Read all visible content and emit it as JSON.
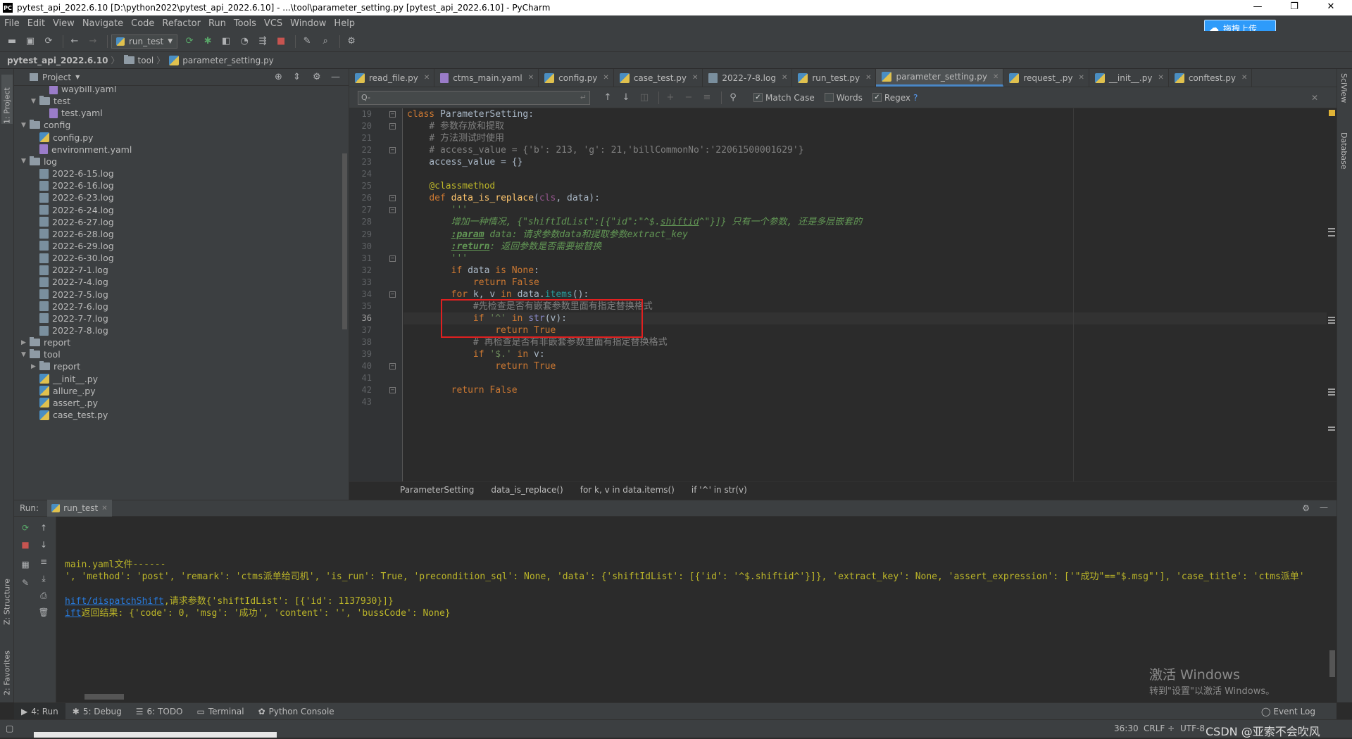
{
  "window": {
    "title": "pytest_api_2022.6.10 [D:\\python2022\\pytest_api_2022.6.10] - ...\\tool\\parameter_setting.py [pytest_api_2022.6.10] - PyCharm",
    "app_icon": "PC",
    "minimize": "—",
    "maximize": "❐",
    "close": "✕"
  },
  "menu": [
    "File",
    "Edit",
    "View",
    "Navigate",
    "Code",
    "Refactor",
    "Run",
    "Tools",
    "VCS",
    "Window",
    "Help"
  ],
  "upload_button": {
    "label": "拖拽上传",
    "icon": "cloud-icon"
  },
  "toolbar": {
    "run_config": "run_test"
  },
  "breadcrumb": [
    "pytest_api_2022.6.10",
    "tool",
    "parameter_setting.py"
  ],
  "left_stripe": {
    "project": "1: Project",
    "structure": "Z: Structure",
    "favorites": "2: Favorites"
  },
  "right_stripe": {
    "sciview": "SciView",
    "database": "Database"
  },
  "project_panel": {
    "title": "Project",
    "tree": [
      {
        "label": "waybill.yaml",
        "indent": 3,
        "kind": "yml",
        "arrow": ""
      },
      {
        "label": "test",
        "indent": 2,
        "kind": "folder",
        "arrow": "▼"
      },
      {
        "label": "test.yaml",
        "indent": 3,
        "kind": "yml",
        "arrow": ""
      },
      {
        "label": "config",
        "indent": 1,
        "kind": "folder",
        "arrow": "▼"
      },
      {
        "label": "config.py",
        "indent": 2,
        "kind": "py",
        "arrow": ""
      },
      {
        "label": "environment.yaml",
        "indent": 2,
        "kind": "yml",
        "arrow": ""
      },
      {
        "label": "log",
        "indent": 1,
        "kind": "folder",
        "arrow": "▼"
      },
      {
        "label": "2022-6-15.log",
        "indent": 2,
        "kind": "log",
        "arrow": ""
      },
      {
        "label": "2022-6-16.log",
        "indent": 2,
        "kind": "log",
        "arrow": ""
      },
      {
        "label": "2022-6-23.log",
        "indent": 2,
        "kind": "log",
        "arrow": ""
      },
      {
        "label": "2022-6-24.log",
        "indent": 2,
        "kind": "log",
        "arrow": ""
      },
      {
        "label": "2022-6-27.log",
        "indent": 2,
        "kind": "log",
        "arrow": ""
      },
      {
        "label": "2022-6-28.log",
        "indent": 2,
        "kind": "log",
        "arrow": ""
      },
      {
        "label": "2022-6-29.log",
        "indent": 2,
        "kind": "log",
        "arrow": ""
      },
      {
        "label": "2022-6-30.log",
        "indent": 2,
        "kind": "log",
        "arrow": ""
      },
      {
        "label": "2022-7-1.log",
        "indent": 2,
        "kind": "log",
        "arrow": ""
      },
      {
        "label": "2022-7-4.log",
        "indent": 2,
        "kind": "log",
        "arrow": ""
      },
      {
        "label": "2022-7-5.log",
        "indent": 2,
        "kind": "log",
        "arrow": ""
      },
      {
        "label": "2022-7-6.log",
        "indent": 2,
        "kind": "log",
        "arrow": ""
      },
      {
        "label": "2022-7-7.log",
        "indent": 2,
        "kind": "log",
        "arrow": ""
      },
      {
        "label": "2022-7-8.log",
        "indent": 2,
        "kind": "log",
        "arrow": ""
      },
      {
        "label": "report",
        "indent": 1,
        "kind": "folder",
        "arrow": "▶"
      },
      {
        "label": "tool",
        "indent": 1,
        "kind": "folder",
        "arrow": "▼"
      },
      {
        "label": "report",
        "indent": 2,
        "kind": "folder",
        "arrow": "▶"
      },
      {
        "label": "__init__.py",
        "indent": 2,
        "kind": "py",
        "arrow": ""
      },
      {
        "label": "allure_.py",
        "indent": 2,
        "kind": "py",
        "arrow": ""
      },
      {
        "label": "assert_.py",
        "indent": 2,
        "kind": "py",
        "arrow": ""
      },
      {
        "label": "case_test.py",
        "indent": 2,
        "kind": "py",
        "arrow": ""
      }
    ]
  },
  "tabs": [
    {
      "label": "read_file.py",
      "kind": "py",
      "active": false
    },
    {
      "label": "ctms_main.yaml",
      "kind": "yml",
      "active": false
    },
    {
      "label": "config.py",
      "kind": "py",
      "active": false
    },
    {
      "label": "case_test.py",
      "kind": "py",
      "active": false
    },
    {
      "label": "2022-7-8.log",
      "kind": "log",
      "active": false
    },
    {
      "label": "run_test.py",
      "kind": "py",
      "active": false
    },
    {
      "label": "parameter_setting.py",
      "kind": "py",
      "active": true
    },
    {
      "label": "request_.py",
      "kind": "py",
      "active": false
    },
    {
      "label": "__init__.py",
      "kind": "py",
      "active": false
    },
    {
      "label": "conftest.py",
      "kind": "py",
      "active": false
    }
  ],
  "find": {
    "match_case": "Match Case",
    "words": "Words",
    "regex": "Regex",
    "help": "?",
    "search_icon": "Q-"
  },
  "editor": {
    "current_line": 36,
    "lines": [
      {
        "n": 19,
        "fold": "⊖",
        "html": "<span class='k'>class </span>ParameterSetting:"
      },
      {
        "n": 20,
        "fold": "⊖",
        "html": "    <span class='cm'># 参数存放和提取</span>"
      },
      {
        "n": 21,
        "fold": "",
        "html": "    <span class='cm'># 方法测试时使用</span>"
      },
      {
        "n": 22,
        "fold": "⊖",
        "html": "    <span class='cm'># access_value = {'b': 213, 'g': 21,'billCommonNo':'22061500001629'}</span>"
      },
      {
        "n": 23,
        "fold": "",
        "html": "    access_value = {}"
      },
      {
        "n": 24,
        "fold": "",
        "html": ""
      },
      {
        "n": 25,
        "fold": "",
        "html": "    <span class='dec'>@classmethod</span>"
      },
      {
        "n": 26,
        "fold": "⊖",
        "html": "    <span class='k'>def </span><span class='fn'>data_is_replace</span>(<span class='sf'>cls</span>, data):"
      },
      {
        "n": 27,
        "fold": "⊖",
        "html": "        <span class='dc'>'''</span>"
      },
      {
        "n": 28,
        "fold": "",
        "html": "        <span class='dc'>增加一种情况, {\"shiftIdList\":[{\"id\":\"^$.<u>shiftid</u>^\"}]} 只有一个参数, 还是多层嵌套的</span>"
      },
      {
        "n": 29,
        "fold": "",
        "html": "        <span class='dct'>:param</span><span class='dc'> data: 请求参数data和提取参数extract_key</span>"
      },
      {
        "n": 30,
        "fold": "",
        "html": "        <span class='dct'>:return</span><span class='dc'>: 返回参数是否需要被替换</span>"
      },
      {
        "n": 31,
        "fold": "⊖",
        "html": "        <span class='dc'>'''</span>"
      },
      {
        "n": 32,
        "fold": "",
        "html": "        <span class='k'>if </span>data <span class='k'>is None</span>:"
      },
      {
        "n": 33,
        "fold": "",
        "html": "            <span class='k'>return False</span>"
      },
      {
        "n": 34,
        "fold": "⊖",
        "html": "        <span class='k'>for </span>k, v <span class='k'>in </span>data.<span class='mt'>items</span>():"
      },
      {
        "n": 35,
        "fold": "",
        "html": "            <span class='cm'>#先检查是否有嵌套参数里面有指定替换格式</span>"
      },
      {
        "n": 36,
        "fold": "",
        "html": "            <span class='k'>if </span><span class='st'>'^'</span> <span class='k'>in </span><span class='bi'>str</span>(v):"
      },
      {
        "n": 37,
        "fold": "",
        "html": "                <span class='k'>return True</span>"
      },
      {
        "n": 38,
        "fold": "",
        "html": "            <span class='cm'># 再检查是否有非嵌套参数里面有指定替换格式</span>"
      },
      {
        "n": 39,
        "fold": "",
        "html": "            <span class='k'>if </span><span class='st'>'$.'</span> <span class='k'>in </span>v:"
      },
      {
        "n": 40,
        "fold": "⊖",
        "html": "                <span class='k'>return True</span>"
      },
      {
        "n": 41,
        "fold": "",
        "html": ""
      },
      {
        "n": 42,
        "fold": "⊖",
        "html": "        <span class='k'>return False</span>"
      },
      {
        "n": 43,
        "fold": "",
        "html": ""
      }
    ]
  },
  "editor_breadcrumb": [
    "ParameterSetting",
    "data_is_replace()",
    "for k, v in data.items()",
    "if '^' in str(v)"
  ],
  "run_panel": {
    "label": "Run:",
    "tab": "run_test"
  },
  "console": [
    {
      "html": "main.yaml文件------"
    },
    {
      "html": "', 'method': 'post', 'remark': 'ctms派单给司机', 'is_run': True, 'precondition_sql': None, 'data': {'shiftIdList': [{'id': '^$.shiftid^'}]}, 'extract_key': None, 'assert_expression': ['\"成功\"==\"$.msg\"'], 'case_title': 'ctms派单'"
    },
    {
      "html": ""
    },
    {
      "html": "<a>hift/dispatchShift</a>,请求参数{'shiftIdList': [{'id': 1137930}]}"
    },
    {
      "html": "<a>ift</a>返回结果: {'code': 0, 'msg': '成功', 'content': '', 'bussCode': None}"
    }
  ],
  "watermark": {
    "line1": "激活 Windows",
    "line2": "转到\"设置\"以激活 Windows。"
  },
  "bottom_tabs": [
    {
      "label": "4: Run",
      "icon": "▶",
      "active": true
    },
    {
      "label": "5: Debug",
      "icon": "✱",
      "active": false
    },
    {
      "label": "6: TODO",
      "icon": "☰",
      "active": false
    },
    {
      "label": "Terminal",
      "icon": "▭",
      "active": false
    },
    {
      "label": "Python Console",
      "icon": "✿",
      "active": false
    }
  ],
  "event_log": "Event Log",
  "status": {
    "position": "36:30",
    "line_sep": "CRLF ÷",
    "encoding": "UTF-8",
    "csdn": "CSDN @亚索不会吹风"
  }
}
